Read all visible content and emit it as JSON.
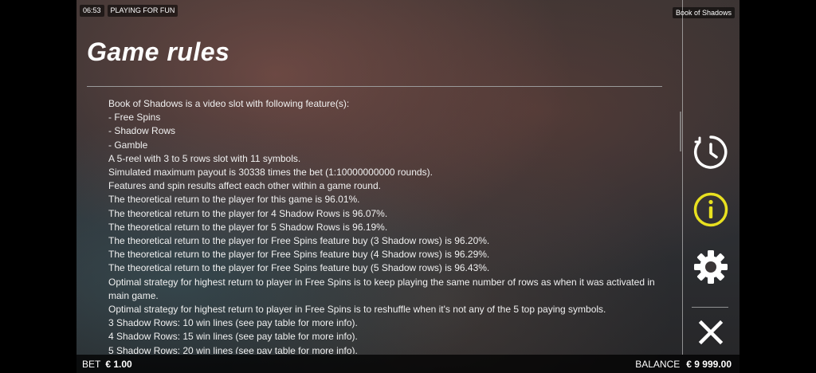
{
  "status": {
    "time": "06:53",
    "mode": "PLAYING FOR FUN",
    "game_name": "Book of Shadows"
  },
  "page_title": "Game rules",
  "rules": [
    {
      "text": "Book of Shadows is a video slot with following feature(s):",
      "bullet": true
    },
    {
      "text": "- Free Spins",
      "bullet": false
    },
    {
      "text": "- Shadow Rows",
      "bullet": false
    },
    {
      "text": "- Gamble",
      "bullet": false
    },
    {
      "text": "A 5-reel with 3 to 5 rows slot with 11 symbols.",
      "bullet": true
    },
    {
      "text": "Simulated maximum payout is 30338 times the bet (1:10000000000 rounds).",
      "bullet": true
    },
    {
      "text": "Features and spin results affect each other within a game round.",
      "bullet": true
    },
    {
      "text": "The theoretical return to the player for this game is 96.01%.",
      "bullet": true
    },
    {
      "text": "The theoretical return to the player for 4 Shadow Rows is 96.07%.",
      "bullet": true
    },
    {
      "text": "The theoretical return to the player for 5 Shadow Rows is 96.19%.",
      "bullet": true
    },
    {
      "text": "The theoretical return to the player for Free Spins feature buy (3 Shadow rows) is 96.20%.",
      "bullet": true
    },
    {
      "text": "The theoretical return to the player for Free Spins feature buy (4 Shadow rows) is 96.29%.",
      "bullet": true
    },
    {
      "text": "The theoretical return to the player for Free Spins feature buy (5 Shadow rows) is 96.43%.",
      "bullet": true
    },
    {
      "text": "Optimal strategy for highest return to player in Free Spins is to keep playing the same number of rows as when it was activated in main game.",
      "bullet": true
    },
    {
      "text": "Optimal strategy for highest return to player in Free Spins is to reshuffle when it's not any of the 5 top paying symbols.",
      "bullet": true
    },
    {
      "text": "3 Shadow Rows: 10 win lines (see pay table for more info).",
      "bullet": true
    },
    {
      "text": "4 Shadow Rows: 15 win lines (see pay table for more info).",
      "bullet": true
    },
    {
      "text": "5 Shadow Rows: 20 win lines (see pay table for more info).",
      "bullet": true
    }
  ],
  "side_buttons": [
    {
      "icon": "history-clock-icon",
      "color": "#ffffff"
    },
    {
      "icon": "info-icon",
      "color": "#e8e020"
    },
    {
      "icon": "gear-icon",
      "color": "#ffffff"
    },
    {
      "icon": "close-icon",
      "color": "#ffffff"
    }
  ],
  "footer": {
    "bet_label": "BET",
    "bet_value": "€ 1.00",
    "balance_label": "BALANCE",
    "balance_value": "€ 9 999.00"
  },
  "colors": {
    "accent_info": "#e8e020"
  }
}
